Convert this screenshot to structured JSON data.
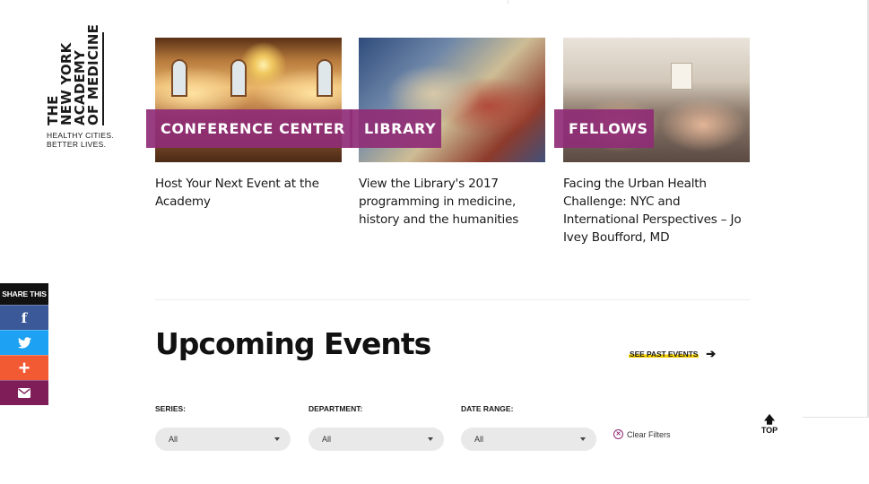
{
  "logo": {
    "lines": [
      "THE",
      "NEW YORK",
      "ACADEMY",
      "OF MEDICINE"
    ],
    "tagline_1": "HEALTHY CITIES.",
    "tagline_2": "BETTER LIVES."
  },
  "features": [
    {
      "label": "CONFERENCE CENTER",
      "title": "Host Your Next Event at the Academy"
    },
    {
      "label": "LIBRARY",
      "title": "View the Library's 2017 programming in medicine, history and the humanities"
    },
    {
      "label": "FELLOWS",
      "title": "Facing the Urban Health Challenge: NYC and International Perspectives – Jo Ivey Boufford, MD"
    }
  ],
  "share": {
    "heading": "SHARE THIS",
    "buttons": [
      {
        "icon": "facebook-icon",
        "glyph": "f",
        "color": "#3b5998"
      },
      {
        "icon": "twitter-icon",
        "glyph": "",
        "color": "#1da1f2"
      },
      {
        "icon": "plus-icon",
        "glyph": "+",
        "color": "#f25a33"
      },
      {
        "icon": "email-icon",
        "glyph": "",
        "color": "#7f1d58"
      }
    ]
  },
  "events": {
    "title": "Upcoming Events",
    "past_link": "SEE PAST EVENTS",
    "filters": [
      {
        "label": "SERIES:",
        "value": "All"
      },
      {
        "label": "DEPARTMENT:",
        "value": "All"
      },
      {
        "label": "DATE RANGE:",
        "value": "All"
      }
    ],
    "clear_label": "Clear Filters"
  },
  "back_to_top": "TOP",
  "colors": {
    "accent": "#8f2d76",
    "highlight": "#f5d000"
  }
}
